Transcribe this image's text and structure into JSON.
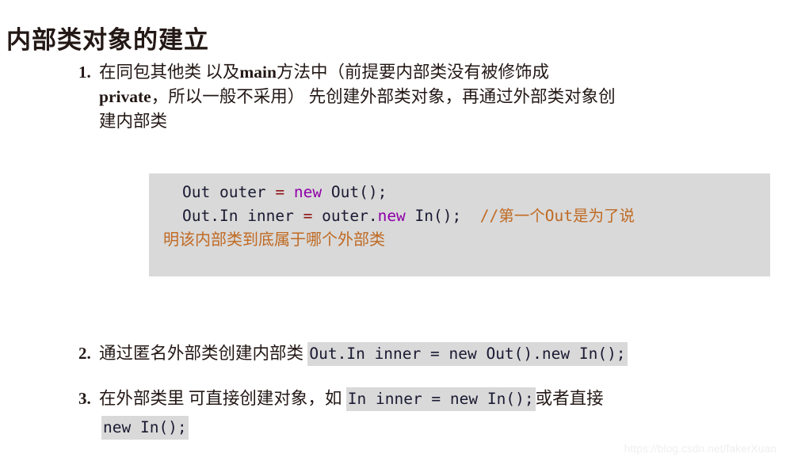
{
  "slide": {
    "title": "内部类对象的建立",
    "background_color": "#ffffff",
    "text_color": "#231815"
  },
  "items": [
    {
      "marker": "1.",
      "lines": [
        {
          "pre": "在同包其他类 以及",
          "latin": "main",
          "post": "方法中（前提要内部类没有被修饰成"
        },
        {
          "pre": "",
          "latin": "private",
          "post": "，所以一般不采用） 先创建外部类对象，再通过外部类对象创"
        },
        {
          "pre": "建内部类",
          "latin": "",
          "post": ""
        }
      ]
    },
    {
      "marker": "2.",
      "text": "通过匿名外部类创建内部类 ",
      "inline_code": "Out.In inner = new Out().new In();"
    },
    {
      "marker": "3.",
      "text_before": "在外部类里 可直接创建对象，如 ",
      "inline_code": "In inner = new In();",
      "text_after": "或者直接",
      "inline_code_2": "new In();"
    }
  ],
  "code_block": {
    "background_color": "#d9d9d9",
    "line1": {
      "type_name": "Out ",
      "var_name": "outer ",
      "operator": "= ",
      "keyword": "new ",
      "call": "Out();"
    },
    "line2": {
      "type_name": "Out.In ",
      "var_name": "inner ",
      "operator": "= ",
      "receiver": "outer.",
      "keyword": "new",
      "call": " In();",
      "comment": "  //第一个Out是为了说"
    },
    "line3_comment": "明该内部类到底属于哪个外部类",
    "colors": {
      "identifier": "#1a1a33",
      "operator": "#8f1515",
      "keyword": "#8f00a8",
      "comment": "#c06a23"
    }
  },
  "watermark": {
    "text": "https://blog.csdn.net/fakerXuan"
  }
}
